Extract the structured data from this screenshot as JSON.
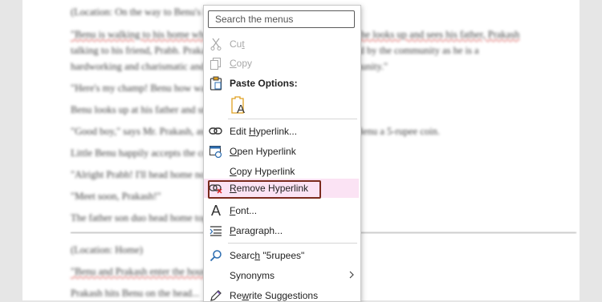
{
  "document": {
    "lines": [
      "(Location: On the way to Benu's house)",
      "\"Benu is walking to his home when he hears someone calling his name, he looks up and sees his father, Prakash",
      "talking to his friend, Prabh. Prakash is a well-known person who is loved by the community as he is a",
      "hardworking and charismatic and a well-respected member of the community.\"",
      "\"Here's my champ! Benu how was your day?\"",
      "Benu looks up at his father and smiles.",
      "\"Good boy,\" says Mr. Prakash, as he reaches into his pocket and hands Benu a 5-rupee coin.",
      "Little Benu happily accepts the coin and thanks his father.",
      "\"Alright Prabh! I'll head home now.\"",
      "\"Meet soon, Prakash!\"",
      "The father son duo head home together.",
      "(Location: Home)",
      "\"Benu and Prakash enter the house.\"",
      "Prakash hits Benu on the head..."
    ]
  },
  "menu": {
    "search_placeholder": "Search the menus",
    "cut": {
      "label": "Cut",
      "underline": "t"
    },
    "copy": {
      "label": "Copy",
      "underline": "C"
    },
    "paste_options": "Paste Options:",
    "paste_keep_text_only": "A",
    "edit_hyperlink": {
      "pre": "Edit ",
      "u": "H",
      "post": "yperlink..."
    },
    "open_hyperlink": {
      "pre": "",
      "u": "O",
      "post": "pen Hyperlink"
    },
    "copy_hyperlink": {
      "pre": "",
      "u": "C",
      "post": "opy Hyperlink"
    },
    "remove_hyperlink": {
      "pre": "",
      "u": "R",
      "post": "emove Hyperlink"
    },
    "font": {
      "pre": "",
      "u": "F",
      "post": "ont..."
    },
    "paragraph": {
      "pre": "",
      "u": "P",
      "post": "aragraph..."
    },
    "search": {
      "pre": "Searc",
      "u": "h",
      "post": " \"5rupees\""
    },
    "synonyms": {
      "pre": "Synonyms",
      "u": "",
      "post": ""
    },
    "rewrite": {
      "pre": "Re",
      "u": "w",
      "post": "rite Suggestions"
    }
  },
  "colors": {
    "highlight": "#fbe3f4",
    "outline": "#7a2b1d",
    "icon_blue": "#2b6cb0",
    "icon_orange": "#e0a020"
  }
}
